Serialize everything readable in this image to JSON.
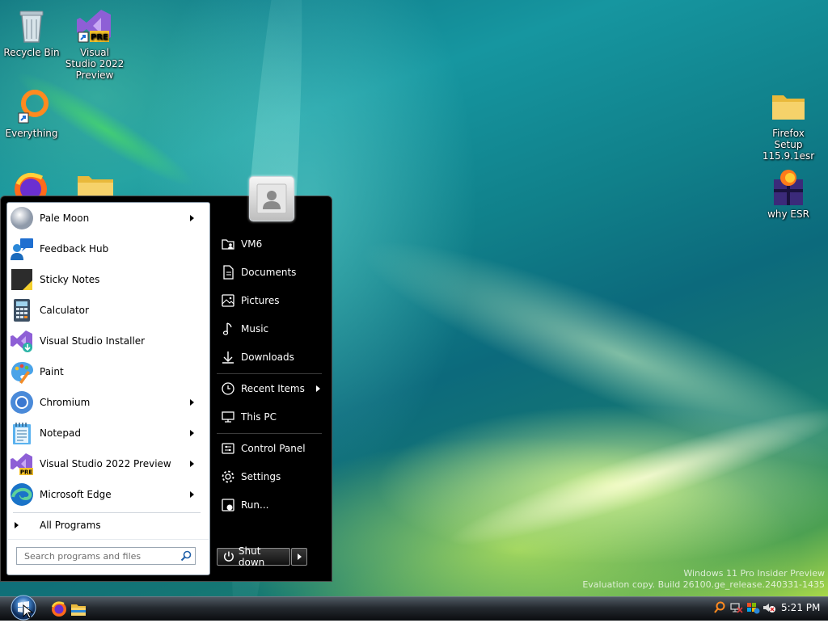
{
  "desktop": {
    "icons": [
      {
        "label": "Recycle Bin",
        "icon": "recycle-bin-icon"
      },
      {
        "label": "Visual Studio 2022 Preview",
        "icon": "visual-studio-preview-icon"
      },
      {
        "label": "Everything",
        "icon": "everything-search-icon"
      },
      {
        "label": "Firefox Setup 115.9.1esr",
        "icon": "folder-icon"
      },
      {
        "label": "why ESR",
        "icon": "firefox-gift-icon"
      }
    ],
    "watermark_line1": "Windows 11 Pro Insider Preview",
    "watermark_line2": "Evaluation copy. Build 26100.ge_release.240331-1435"
  },
  "start_menu": {
    "programs": [
      {
        "label": "Pale Moon",
        "submenu": true,
        "icon": "pale-moon-icon"
      },
      {
        "label": "Feedback Hub",
        "submenu": false,
        "icon": "feedback-hub-icon"
      },
      {
        "label": "Sticky Notes",
        "submenu": false,
        "icon": "sticky-notes-icon"
      },
      {
        "label": "Calculator",
        "submenu": false,
        "icon": "calculator-icon"
      },
      {
        "label": "Visual Studio Installer",
        "submenu": false,
        "icon": "visual-studio-installer-icon"
      },
      {
        "label": "Paint",
        "submenu": false,
        "icon": "paint-icon"
      },
      {
        "label": "Chromium",
        "submenu": true,
        "icon": "chromium-icon"
      },
      {
        "label": "Notepad",
        "submenu": true,
        "icon": "notepad-icon"
      },
      {
        "label": "Visual Studio 2022 Preview",
        "submenu": true,
        "icon": "visual-studio-preview-icon"
      },
      {
        "label": "Microsoft Edge",
        "submenu": true,
        "icon": "edge-icon"
      }
    ],
    "all_programs": "All Programs",
    "search_placeholder": "Search programs and files",
    "right_items": [
      {
        "label": "VM6",
        "icon": "user-folder-icon"
      },
      {
        "label": "Documents",
        "icon": "document-icon"
      },
      {
        "label": "Pictures",
        "icon": "picture-icon"
      },
      {
        "label": "Music",
        "icon": "music-note-icon"
      },
      {
        "label": "Downloads",
        "icon": "download-icon"
      },
      {
        "label": "Recent Items",
        "icon": "clock-icon",
        "submenu": true
      },
      {
        "label": "This PC",
        "icon": "computer-icon"
      },
      {
        "label": "Control Panel",
        "icon": "control-panel-icon"
      },
      {
        "label": "Settings",
        "icon": "gear-icon"
      },
      {
        "label": "Run...",
        "icon": "run-icon"
      }
    ],
    "shutdown_label": "Shut down"
  },
  "taskbar": {
    "clock": "5:21 PM",
    "pinned": [
      "firefox-icon",
      "file-explorer-icon"
    ],
    "tray": [
      "everything-tray-icon",
      "network-icon",
      "shield-flag-icon",
      "volume-muted-icon"
    ]
  },
  "colors": {
    "menu_bg": "#000000",
    "taskbar": "#1a1e23",
    "accent_blue": "#1f6fd0"
  }
}
